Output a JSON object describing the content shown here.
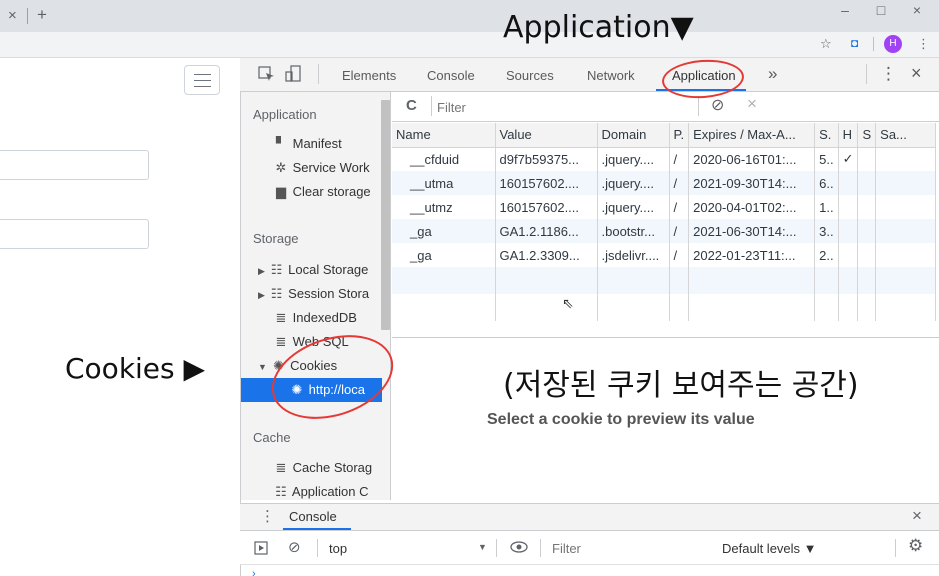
{
  "browser": {
    "tab_close": "×",
    "new_tab": "+",
    "win_min": "–",
    "win_max": "□",
    "win_close": "×",
    "star": "☆",
    "ext": "◘",
    "avatar": "H",
    "menu": "⋮"
  },
  "devtools": {
    "tabs": [
      "Elements",
      "Console",
      "Sources",
      "Network",
      "Application"
    ],
    "more": "»",
    "kebab": "⋮",
    "close": "×",
    "sidebar": {
      "application_header": "Application",
      "application_items": [
        "Manifest",
        "Service Work",
        "Clear storage"
      ],
      "storage_header": "Storage",
      "storage_items": [
        "Local Storage",
        "Session Stora",
        "IndexedDB",
        "Web SQL",
        "Cookies"
      ],
      "cookie_child": "http://loca",
      "cache_header": "Cache",
      "cache_items": [
        "Cache Storag",
        "Application C"
      ]
    },
    "filter": {
      "refresh": "C",
      "placeholder": "Filter",
      "clear_icon": "⊘",
      "delete_icon": "×"
    },
    "table": {
      "headers": [
        "Name",
        "Value",
        "Domain",
        "P.",
        "Expires / Max-A...",
        "S.",
        "H",
        "S",
        "Sa..."
      ],
      "rows": [
        [
          "__cfduid",
          "d9f7b59375...",
          ".jquery....",
          "/",
          "2020-06-16T01:...",
          "5..",
          "✓",
          "",
          ""
        ],
        [
          "__utma",
          "160157602....",
          ".jquery....",
          "/",
          "2021-09-30T14:...",
          "6..",
          "",
          "",
          ""
        ],
        [
          "__utmz",
          "160157602....",
          ".jquery....",
          "/",
          "2020-04-01T02:...",
          "1..",
          "",
          "",
          ""
        ],
        [
          "_ga",
          "GA1.2.1186...",
          ".bootstr...",
          "/",
          "2021-06-30T14:...",
          "3..",
          "",
          "",
          ""
        ],
        [
          "_ga",
          "GA1.2.3309...",
          ".jsdelivr....",
          "/",
          "2022-01-23T11:...",
          "2..",
          "",
          "",
          ""
        ]
      ]
    },
    "preview_text": "Select a cookie to preview its value",
    "drawer": {
      "title": "Console",
      "close": "×",
      "context": "top",
      "filter_placeholder": "Filter",
      "levels": "Default levels ▼"
    }
  },
  "annotations": {
    "application": "Application▼",
    "cookies": "Cookies ▶",
    "korean": "(저장된 쿠키 보여주는 공간)",
    "color": "#e53935"
  }
}
